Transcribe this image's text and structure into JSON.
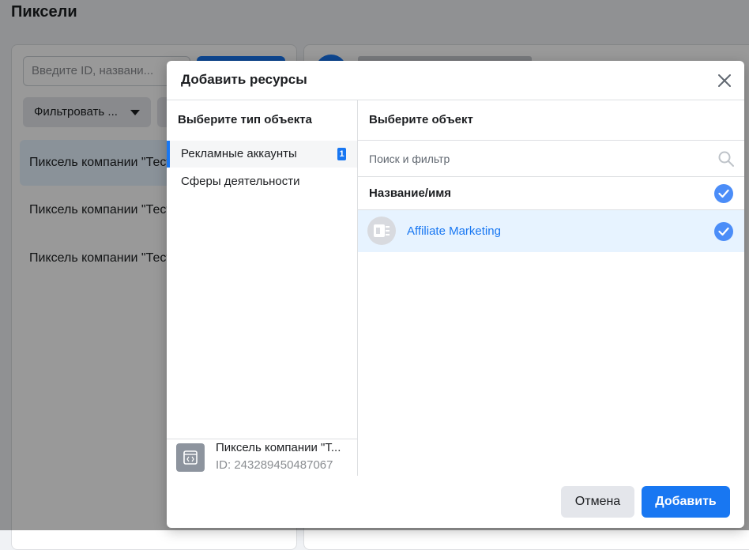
{
  "page": {
    "title": "Пиксели",
    "search_placeholder": "Введите ID, названи...",
    "filter_label": "Фильтровать ...",
    "rows": [
      "Пиксель компании \"Тест",
      "Пиксель компании \"Тест",
      "Пиксель компании \"Тест"
    ]
  },
  "modal": {
    "title": "Добавить ресурсы",
    "left_header": "Выберите тип объекта",
    "types": [
      {
        "label": "Рекламные аккаунты",
        "count": "1"
      },
      {
        "label": "Сферы деятельности"
      }
    ],
    "selected_pixel": {
      "name": "Пиксель компании \"Т...",
      "id": "ID: 243289450487067"
    },
    "right_header": "Выберите объект",
    "search_placeholder": "Поиск и фильтр",
    "list_header": "Название/имя",
    "assets": [
      {
        "name": "Affiliate Marketing"
      }
    ],
    "cancel_label": "Отмена",
    "add_label": "Добавить"
  },
  "colors": {
    "accent": "#1877f2",
    "check": "#4b8df8",
    "selected_row": "#e7f3ff"
  },
  "icons": [
    "close-icon",
    "search-icon",
    "check-icon",
    "ad-account-icon",
    "pixel-code-icon",
    "dropdown-caret-icon"
  ]
}
